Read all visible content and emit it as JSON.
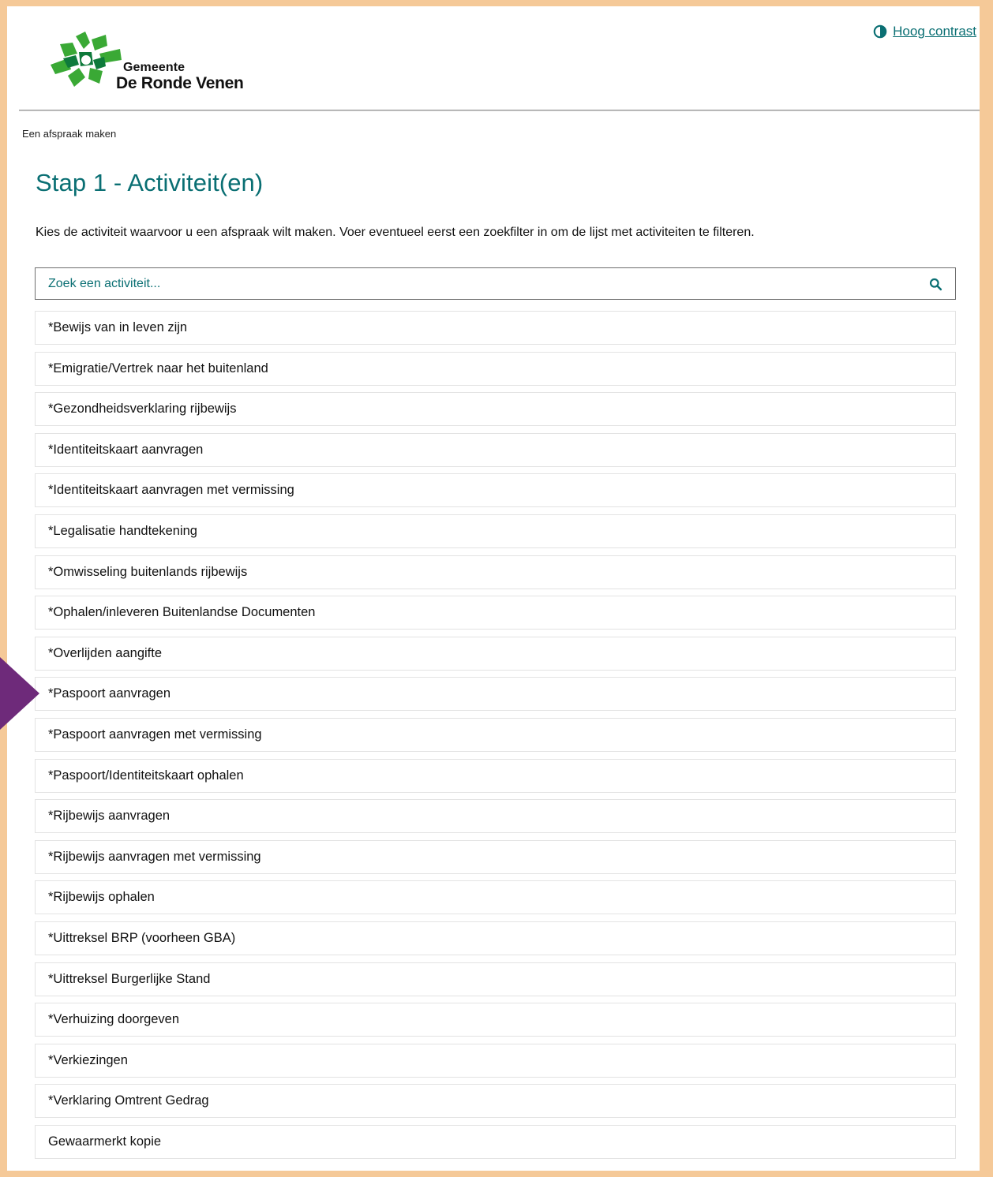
{
  "header": {
    "logo_line1": "Gemeente",
    "logo_line2": "De Ronde Venen",
    "contrast_label": "Hoog contrast",
    "contrast_icon": "contrast-icon",
    "logo_icon": "municipality-logo-icon"
  },
  "breadcrumb": "Een afspraak maken",
  "page": {
    "title": "Stap 1 - Activiteit(en)",
    "intro": "Kies de activiteit waarvoor u een afspraak wilt maken. Voer eventueel eerst een zoekfilter in om de lijst met activiteiten te filteren."
  },
  "search": {
    "placeholder": "Zoek een activiteit...",
    "value": "",
    "icon": "search-icon"
  },
  "activities": [
    "*Bewijs van in leven zijn",
    "*Emigratie/Vertrek naar het buitenland",
    "*Gezondheidsverklaring rijbewijs",
    "*Identiteitskaart aanvragen",
    "*Identiteitskaart aanvragen met vermissing",
    "*Legalisatie handtekening",
    "*Omwisseling buitenlands rijbewijs",
    "*Ophalen/inleveren Buitenlandse Documenten",
    "*Overlijden aangifte",
    "*Paspoort aanvragen",
    "*Paspoort aanvragen met vermissing",
    "*Paspoort/Identiteitskaart ophalen",
    "*Rijbewijs aanvragen",
    "*Rijbewijs aanvragen met vermissing",
    "*Rijbewijs ophalen",
    "*Uittreksel BRP (voorheen GBA)",
    "*Uittreksel Burgerlijke Stand",
    "*Verhuizing doorgeven",
    "*Verkiezingen",
    "*Verklaring Omtrent Gedrag",
    "Gewaarmerkt kopie"
  ],
  "colors": {
    "frame": "#f5c998",
    "accent": "#0a6f73",
    "arrow": "#6e2a7a",
    "logo_green": "#3aa935",
    "logo_dark_green": "#0e7a3b"
  }
}
